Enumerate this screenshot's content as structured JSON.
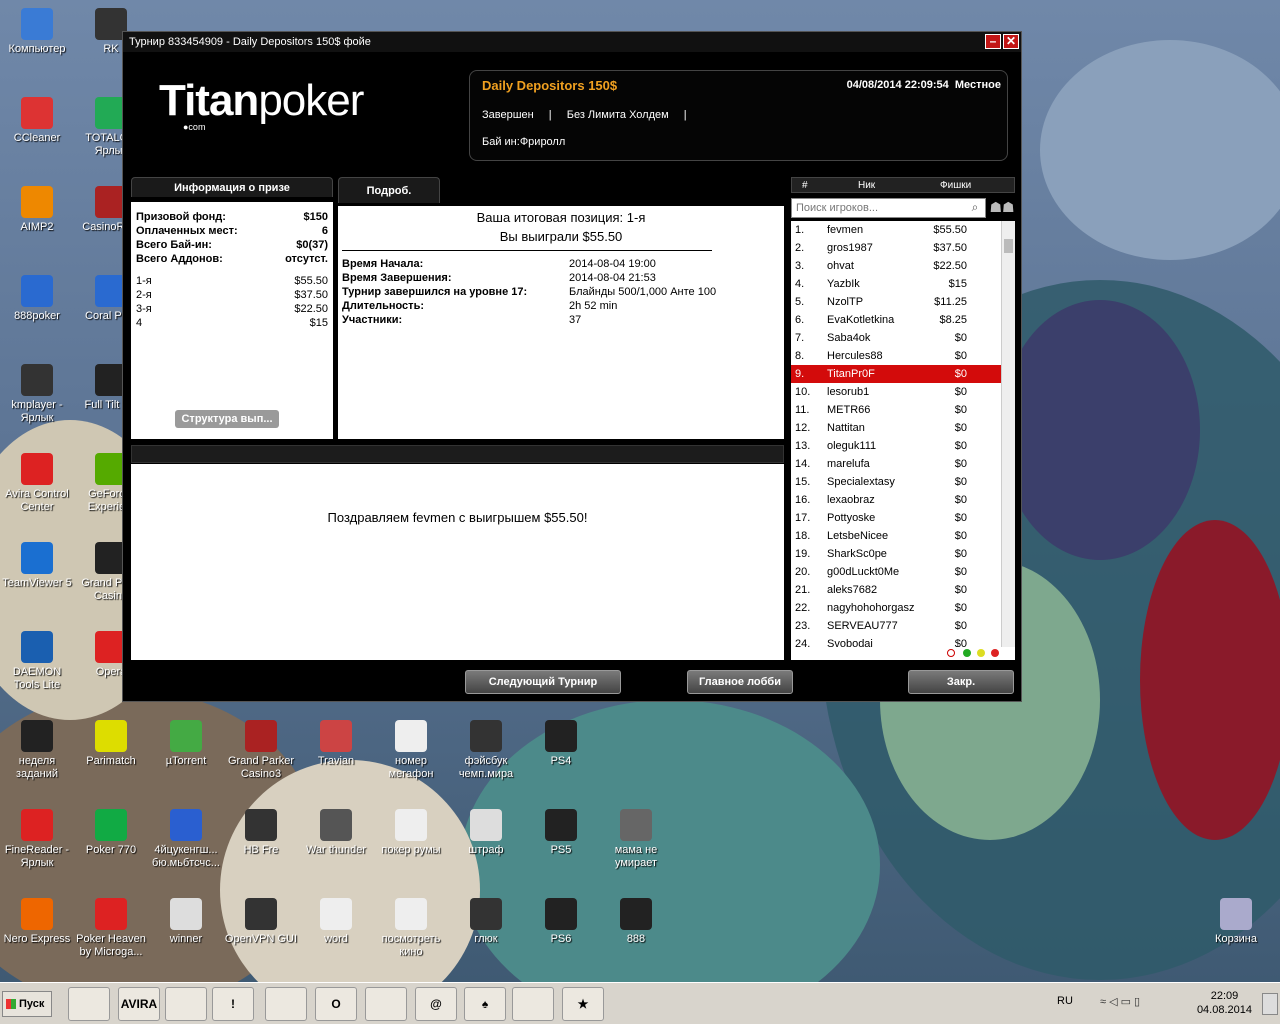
{
  "desktop_icons": [
    {
      "id": "komp",
      "label": "Компьютер",
      "icon": "computer-icon",
      "color": "#3a7bd5"
    },
    {
      "id": "rk",
      "label": "RK",
      "icon": "app-icon",
      "color": "#333"
    },
    {
      "id": "ccleaner",
      "label": "CCleaner",
      "icon": "ccleaner-icon",
      "color": "#d33"
    },
    {
      "id": "total",
      "label": "TOTALC... Ярлык",
      "icon": "app-icon",
      "color": "#2a5"
    },
    {
      "id": "aimp",
      "label": "AIMP2",
      "icon": "aimp-icon",
      "color": "#e80"
    },
    {
      "id": "casino",
      "label": "CasinoRe...",
      "icon": "app-icon",
      "color": "#a22"
    },
    {
      "id": "p888",
      "label": "888poker",
      "icon": "shortcut-icon",
      "color": "#2a6ad0"
    },
    {
      "id": "coral",
      "label": "Coral Po...",
      "icon": "shortcut-icon",
      "color": "#2a6ad0"
    },
    {
      "id": "kmp",
      "label": "kmplayer - Ярлык",
      "icon": "kmp-icon",
      "color": "#333"
    },
    {
      "id": "fulltilt",
      "label": "Full Tilt P...",
      "icon": "app-icon",
      "color": "#222"
    },
    {
      "id": "avira",
      "label": "Avira Control Center",
      "icon": "avira-icon",
      "color": "#d22"
    },
    {
      "id": "geforce",
      "label": "GeForc... Experie...",
      "icon": "geforce-icon",
      "color": "#5a0"
    },
    {
      "id": "teamviewer",
      "label": "TeamViewer 5",
      "icon": "teamviewer-icon",
      "color": "#1a6fd1"
    },
    {
      "id": "grandpar",
      "label": "Grand Par... Casino",
      "icon": "app-icon",
      "color": "#222"
    },
    {
      "id": "daemon",
      "label": "DAEMON Tools Lite",
      "icon": "daemon-icon",
      "color": "#1a5fb0"
    },
    {
      "id": "opera1",
      "label": "Opera",
      "icon": "opera-icon",
      "color": "#d22"
    },
    {
      "id": "nedelya",
      "label": "неделя заданий",
      "icon": "app-icon",
      "color": "#222"
    },
    {
      "id": "parimatch",
      "label": "Parimatch",
      "icon": "parimatch-icon",
      "color": "#dd0"
    },
    {
      "id": "utorrent",
      "label": "µTorrent",
      "icon": "utorrent-icon",
      "color": "#4a4"
    },
    {
      "id": "gpc3",
      "label": "Grand Parker Casino3",
      "icon": "app-icon",
      "color": "#a22"
    },
    {
      "id": "travian",
      "label": "Travian",
      "icon": "app-icon",
      "color": "#c44"
    },
    {
      "id": "nomer",
      "label": "номер мегафон",
      "icon": "file-icon",
      "color": "#eee"
    },
    {
      "id": "fb",
      "label": "фэйсбук чемп.мира",
      "icon": "app-icon",
      "color": "#333"
    },
    {
      "id": "ps4",
      "label": "PS4",
      "icon": "app-icon",
      "color": "#222"
    },
    {
      "id": "finereader",
      "label": "FineReader - Ярлык",
      "icon": "finereader-icon",
      "color": "#d22"
    },
    {
      "id": "poker770",
      "label": "Poker 770",
      "icon": "app-icon",
      "color": "#1a4"
    },
    {
      "id": "doc4",
      "label": "4йцукенгш... бю.мьбтсчс...",
      "icon": "doc-icon",
      "color": "#2a5fd0"
    },
    {
      "id": "hbfre",
      "label": "HB Fre",
      "icon": "app-icon",
      "color": "#333"
    },
    {
      "id": "warthunder",
      "label": "War thunder",
      "icon": "app-icon",
      "color": "#555"
    },
    {
      "id": "pokerrumy",
      "label": "покер румы",
      "icon": "file-icon",
      "color": "#eee"
    },
    {
      "id": "shtraf",
      "label": "штраф",
      "icon": "app-icon",
      "color": "#ddd"
    },
    {
      "id": "ps5",
      "label": "PS5",
      "icon": "app-icon",
      "color": "#222"
    },
    {
      "id": "mama",
      "label": "мама не умирает",
      "icon": "app-icon",
      "color": "#666"
    },
    {
      "id": "nero",
      "label": "Nero Express",
      "icon": "nero-icon",
      "color": "#e60"
    },
    {
      "id": "pokerheaven",
      "label": "Poker Heaven by Microga...",
      "icon": "app-icon",
      "color": "#d22"
    },
    {
      "id": "winner",
      "label": "winner",
      "icon": "app-icon",
      "color": "#ddd"
    },
    {
      "id": "openvpn",
      "label": "OpenVPN GUI",
      "icon": "app-icon",
      "color": "#333"
    },
    {
      "id": "word",
      "label": "word",
      "icon": "file-icon",
      "color": "#eee"
    },
    {
      "id": "kino",
      "label": "посмотреть кино",
      "icon": "file-icon",
      "color": "#eee"
    },
    {
      "id": "gluk",
      "label": "глюк",
      "icon": "app-icon",
      "color": "#333"
    },
    {
      "id": "ps6",
      "label": "PS6",
      "icon": "app-icon",
      "color": "#222"
    },
    {
      "id": "i888",
      "label": "888",
      "icon": "app-icon",
      "color": "#222"
    },
    {
      "id": "korzina",
      "label": "Корзина",
      "icon": "recycle-bin-icon",
      "color": "#aac"
    }
  ],
  "window": {
    "title": "Турнир 833454909 - Daily Depositors 150$ фойе",
    "logo_bold": "Titan",
    "logo_light": "poker",
    "logo_com": "●com",
    "tournament": {
      "name": "Daily Depositors 150$",
      "datetime": "04/08/2014 22:09:54",
      "tz": "Местное",
      "status": "Завершен",
      "sep": "|",
      "game": "Без Лимита Холдем",
      "buyin": "Бай ин:Фриролл"
    },
    "prize": {
      "tab": "Информация о призе",
      "rows": [
        {
          "k": "Призовой фонд:",
          "v": "$150"
        },
        {
          "k": "Оплаченных мест:",
          "v": "6"
        },
        {
          "k": "Всего Бай-ин:",
          "v": "$0(37)"
        },
        {
          "k": "Всего Аддонов:",
          "v": "отсутст."
        }
      ],
      "places": [
        {
          "k": "1-я",
          "v": "$55.50"
        },
        {
          "k": "2-я",
          "v": "$37.50"
        },
        {
          "k": "3-я",
          "v": "$22.50"
        },
        {
          "k": "4",
          "v": "$15"
        }
      ],
      "structure_btn": "Структура вып..."
    },
    "details": {
      "tab": "Подроб.",
      "final_position": "Ваша итоговая позиция: 1-я",
      "won": "Вы выиграли $55.50",
      "rows": [
        {
          "k": "Время Начала:",
          "v": "2014-08-04 19:00"
        },
        {
          "k": "Время Завершения:",
          "v": "2014-08-04 21:53"
        },
        {
          "k": "Турнир завершился на уровне 17:",
          "v": "Блайнды 500/1,000 Анте 100"
        },
        {
          "k": "Длительность:",
          "v": "2h 52 min"
        },
        {
          "k": "Участники:",
          "v": "37"
        }
      ]
    },
    "congrats": "Поздравляем fevmen с выигрышем $55.50!",
    "players": {
      "col_num": "#",
      "col_nick": "Ник",
      "col_chips": "Фишки",
      "search_placeholder": "Поиск игроков...",
      "list": [
        {
          "n": "1.",
          "nick": "fevmen",
          "c": "$55.50"
        },
        {
          "n": "2.",
          "nick": "gros1987",
          "c": "$37.50"
        },
        {
          "n": "3.",
          "nick": "ohvat",
          "c": "$22.50"
        },
        {
          "n": "4.",
          "nick": "YazbIk",
          "c": "$15"
        },
        {
          "n": "5.",
          "nick": "NzolTP",
          "c": "$11.25"
        },
        {
          "n": "6.",
          "nick": "EvaKotletkina",
          "c": "$8.25"
        },
        {
          "n": "7.",
          "nick": "Saba4ok",
          "c": "$0"
        },
        {
          "n": "8.",
          "nick": "Hercules88",
          "c": "$0"
        },
        {
          "n": "9.",
          "nick": "TitanPr0F",
          "c": "$0",
          "selected": true
        },
        {
          "n": "10.",
          "nick": "lesorub1",
          "c": "$0"
        },
        {
          "n": "11.",
          "nick": "METR66",
          "c": "$0"
        },
        {
          "n": "12.",
          "nick": "Nattitan",
          "c": "$0"
        },
        {
          "n": "13.",
          "nick": "oleguk111",
          "c": "$0"
        },
        {
          "n": "14.",
          "nick": "marelufa",
          "c": "$0"
        },
        {
          "n": "15.",
          "nick": "Specialextasy",
          "c": "$0"
        },
        {
          "n": "16.",
          "nick": "lexaobraz",
          "c": "$0"
        },
        {
          "n": "17.",
          "nick": "Pottyoske",
          "c": "$0"
        },
        {
          "n": "18.",
          "nick": "LetsbeNicee",
          "c": "$0"
        },
        {
          "n": "19.",
          "nick": "SharkSc0pe",
          "c": "$0"
        },
        {
          "n": "20.",
          "nick": "g00dLuckt0Me",
          "c": "$0"
        },
        {
          "n": "21.",
          "nick": "aleks7682",
          "c": "$0"
        },
        {
          "n": "22.",
          "nick": "nagyhohohorgasz",
          "c": "$0"
        },
        {
          "n": "23.",
          "nick": "SERVEAU777",
          "c": "$0"
        },
        {
          "n": "24.",
          "nick": "Svobodai",
          "c": "$0"
        }
      ]
    },
    "buttons": {
      "next": "Следующий Турнир",
      "lobby": "Главное лобби",
      "close": "Закр."
    }
  },
  "taskbar": {
    "start": "Пуск",
    "lang": "RU",
    "time": "22:09",
    "date": "04.08.2014",
    "apps": [
      {
        "label": "",
        "icon": "folder-icon"
      },
      {
        "label": "AVIRA",
        "icon": "avira-icon"
      },
      {
        "label": "",
        "icon": "save-disk-icon"
      },
      {
        "label": "!",
        "icon": "alert-icon"
      },
      {
        "label": "",
        "icon": "chrome-icon"
      },
      {
        "label": "O",
        "icon": "opera-icon"
      },
      {
        "label": "",
        "icon": "ring-icon"
      },
      {
        "label": "@",
        "icon": "mail-agent-icon"
      },
      {
        "label": "♠",
        "icon": "spade-icon"
      },
      {
        "label": "",
        "icon": "notepad-icon"
      },
      {
        "label": "★",
        "icon": "pokerstars-icon"
      }
    ]
  }
}
